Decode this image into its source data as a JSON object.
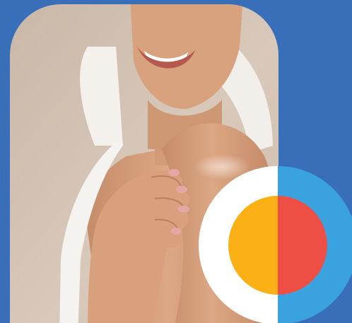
{
  "background_color": "#386fb8",
  "photo": {
    "subject": "woman-applying-body-oil-to-shoulder",
    "icon": "photo-icon",
    "skin_color": "#d9a07d",
    "skin_shadow": "#b9815f",
    "towel_color": "#f4f1ed",
    "wall_color": "#d1bfae"
  },
  "badge": {
    "icon": "split-circle-logo-icon",
    "outer_left_color": "#ffffff",
    "outer_right_color": "#3aa3df",
    "inner_left_color": "#fbb016",
    "inner_right_color": "#ee4f44"
  }
}
